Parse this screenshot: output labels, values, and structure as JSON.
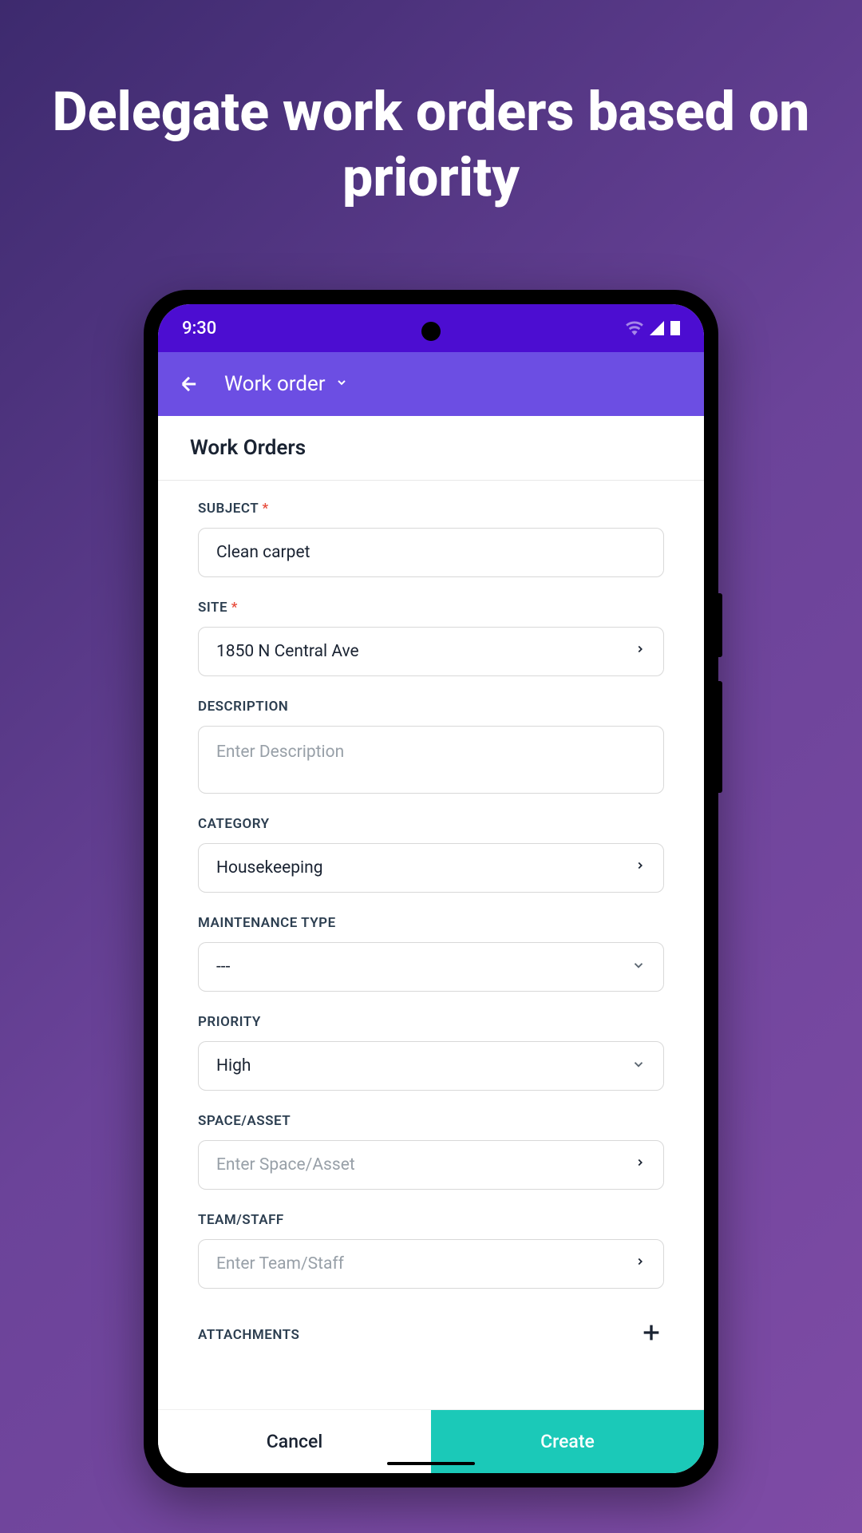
{
  "marketing": {
    "headline": "Delegate work orders based on priority"
  },
  "status_bar": {
    "time": "9:30"
  },
  "header": {
    "title": "Work order"
  },
  "section": {
    "title": "Work Orders"
  },
  "form": {
    "subject": {
      "label": "SUBJECT",
      "value": "Clean carpet",
      "required": true
    },
    "site": {
      "label": "SITE",
      "value": "1850 N Central Ave",
      "required": true
    },
    "description": {
      "label": "DESCRIPTION",
      "placeholder": "Enter Description"
    },
    "category": {
      "label": "CATEGORY",
      "value": "Housekeeping"
    },
    "maintenance_type": {
      "label": "MAINTENANCE TYPE",
      "value": "---"
    },
    "priority": {
      "label": "PRIORITY",
      "value": "High"
    },
    "space_asset": {
      "label": "SPACE/ASSET",
      "placeholder": "Enter Space/Asset"
    },
    "team_staff": {
      "label": "TEAM/STAFF",
      "placeholder": "Enter Team/Staff"
    },
    "attachments": {
      "label": "ATTACHMENTS"
    }
  },
  "buttons": {
    "cancel": "Cancel",
    "create": "Create"
  }
}
